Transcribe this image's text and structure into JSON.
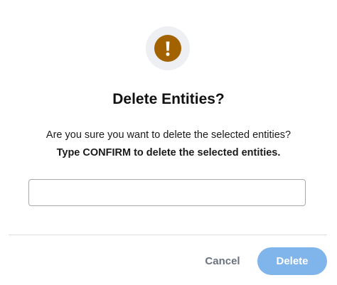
{
  "dialog": {
    "icon": "exclamation-icon",
    "title": "Delete Entities?",
    "message": "Are you sure you want to delete the selected entities?",
    "instruction": "Type CONFIRM to delete the selected entities.",
    "input": {
      "value": "",
      "placeholder": ""
    },
    "actions": {
      "cancel_label": "Cancel",
      "delete_label": "Delete",
      "delete_enabled": false
    }
  },
  "colors": {
    "warning_icon": "#a36200",
    "icon_halo": "#eeeff2",
    "delete_button_disabled": "#80b5ec",
    "cancel_text": "#6b7280"
  }
}
